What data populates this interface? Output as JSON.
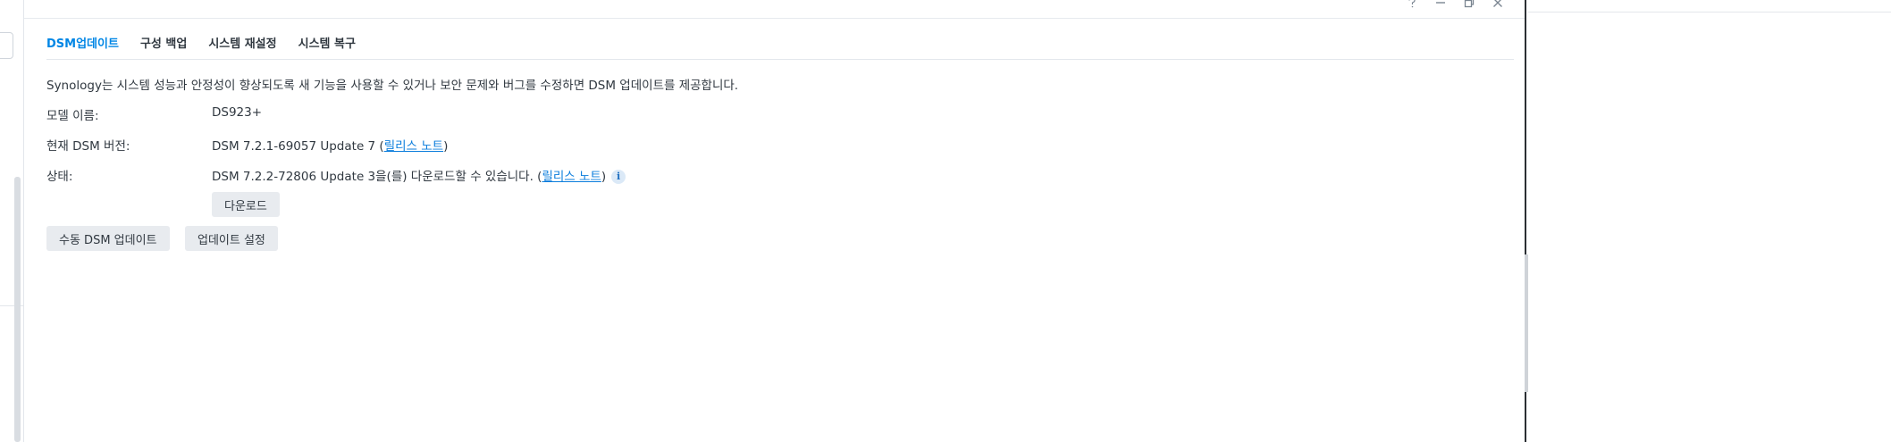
{
  "window": {
    "controls": [
      "help-icon",
      "minimize-icon",
      "maximize-icon",
      "close-icon"
    ]
  },
  "tabs": [
    {
      "label": "DSM업데이트",
      "active": true
    },
    {
      "label": "구성 백업",
      "active": false
    },
    {
      "label": "시스템 재설정",
      "active": false
    },
    {
      "label": "시스템 복구",
      "active": false
    }
  ],
  "description": "Synology는 시스템 성능과 안정성이 향상되도록 새 기능을 사용할 수 있거나 보안 문제와 버그를 수정하면 DSM 업데이트를 제공합니다.",
  "model": {
    "label": "모델 이름:",
    "value": "DS923+"
  },
  "current_version": {
    "label": "현재 DSM 버전:",
    "value": "DSM 7.2.1-69057 Update 7",
    "link": "릴리스 노트"
  },
  "status": {
    "label": "상태:",
    "value": "DSM 7.2.2-72806 Update 3을(를) 다운로드할 수 있습니다.",
    "link": "릴리스 노트",
    "color": "#1a9e2b"
  },
  "buttons": {
    "download": "다운로드",
    "manual_update": "수동 DSM 업데이트",
    "update_settings": "업데이트 설정"
  },
  "colors": {
    "accent": "#0086e5",
    "link": "#0b7ddc",
    "button_bg": "#e8ebef"
  }
}
